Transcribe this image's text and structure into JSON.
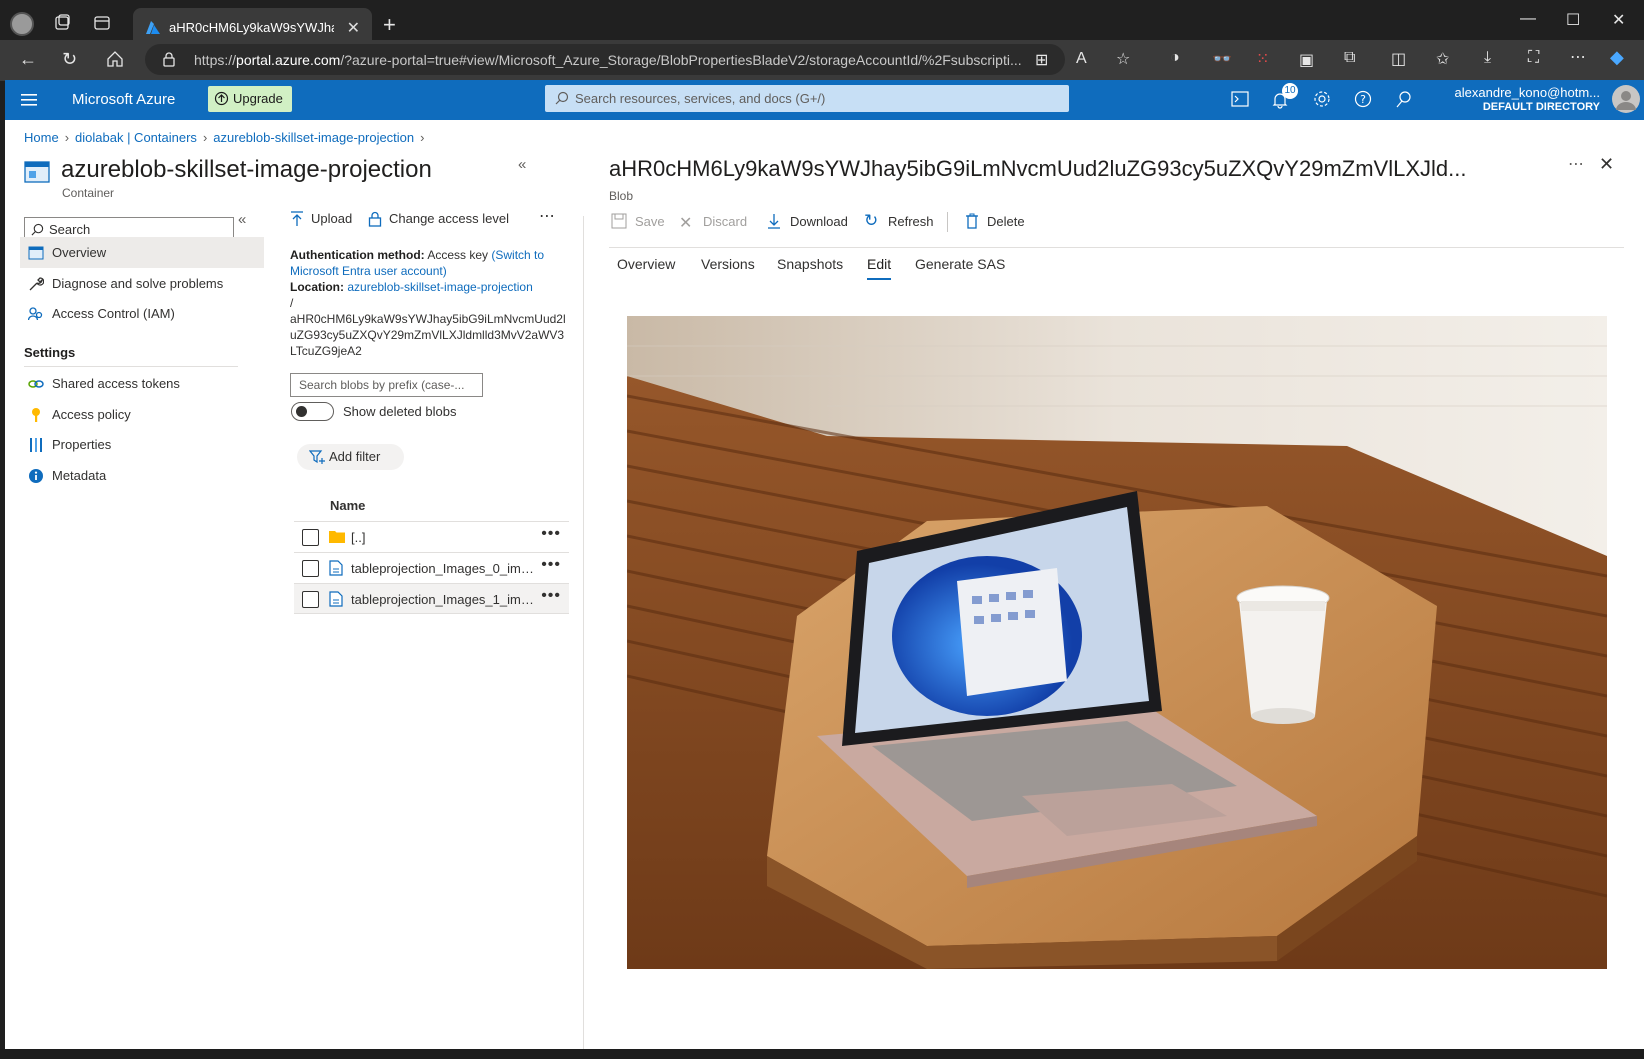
{
  "browser": {
    "tab_title": "aHR0cHM6Ly9kaW9sYWJhay5ibG9iLmNvcmUud2luZG93cy5uZXQvY29mZmVlLXJldmlld3Mv",
    "url_host": "portal.azure.com",
    "url_prefix": "https://",
    "url_rest": "/?azure-portal=true#view/Microsoft_Azure_Storage/BlobPropertiesBladeV2/storageAccountId/%2Fsubscripti..."
  },
  "azure": {
    "brand": "Microsoft Azure",
    "upgrade": "Upgrade",
    "search_placeholder": "Search resources, services, and docs (G+/)",
    "notifications_count": "10",
    "account_name": "alexandre_kono@hotm...",
    "account_directory": "DEFAULT DIRECTORY"
  },
  "breadcrumb": [
    "Home",
    "diolabak | Containers",
    "azureblob-skillset-image-projection"
  ],
  "container": {
    "title": "azureblob-skillset-image-projection",
    "subtitle": "Container",
    "search_placeholder": "Search"
  },
  "nav": {
    "items": [
      {
        "label": "Overview",
        "icon": "container-icon"
      },
      {
        "label": "Diagnose and solve problems",
        "icon": "wrench-icon"
      },
      {
        "label": "Access Control (IAM)",
        "icon": "people-icon"
      }
    ],
    "settings_header": "Settings",
    "settings": [
      {
        "label": "Shared access tokens",
        "icon": "link-icon"
      },
      {
        "label": "Access policy",
        "icon": "key-icon"
      },
      {
        "label": "Properties",
        "icon": "properties-icon"
      },
      {
        "label": "Metadata",
        "icon": "info-icon"
      }
    ]
  },
  "blob_list": {
    "upload": "Upload",
    "change_access": "Change access level",
    "auth_label": "Authentication method:",
    "auth_value": "Access key",
    "auth_switch": "(Switch to Microsoft Entra user account)",
    "location_label": "Location:",
    "location_link": "azureblob-skillset-image-projection",
    "location_slash": "/",
    "location_path": "aHR0cHM6Ly9kaW9sYWJhay5ibG9iLmNvcmUud2luZG93cy5uZXQvY29mZmVlLXJldmlld3MvV2aWV3LTcuZG9jeA2",
    "search_placeholder": "Search blobs by prefix (case-...",
    "show_deleted": "Show deleted blobs",
    "add_filter": "Add filter",
    "col_name": "Name",
    "rows": [
      {
        "name": "[..]",
        "type": "folder"
      },
      {
        "name": "tableprojection_Images_0_img...",
        "type": "file"
      },
      {
        "name": "tableprojection_Images_1_img...",
        "type": "file"
      }
    ]
  },
  "blob": {
    "title": "aHR0cHM6Ly9kaW9sYWJhay5ibG9iLmNvcmUud2luZG93cy5uZXQvY29mZmVlLXJld...",
    "subtitle": "Blob",
    "toolbar": {
      "save": "Save",
      "discard": "Discard",
      "download": "Download",
      "refresh": "Refresh",
      "delete": "Delete"
    },
    "tabs": [
      "Overview",
      "Versions",
      "Snapshots",
      "Edit",
      "Generate SAS"
    ],
    "active_tab": "Edit"
  },
  "colors": {
    "azure_blue": "#0f6cbd",
    "link": "#0f6cbd",
    "upgrade_bg": "#d1f0c4"
  }
}
